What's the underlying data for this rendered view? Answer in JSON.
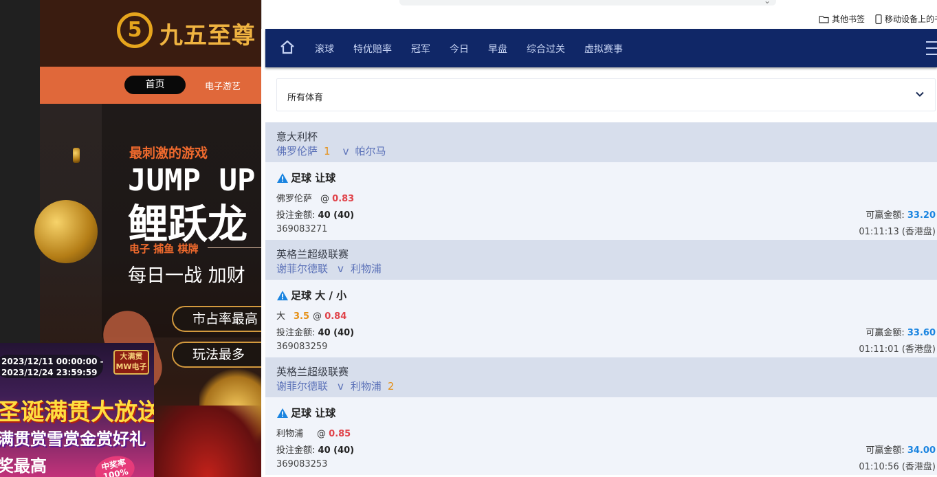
{
  "background_site": {
    "logo_char": "5",
    "logo_text": "九五至尊",
    "nav_home": "首页",
    "nav_egame": "电子游艺",
    "hero_line1": "最刺激的游戏",
    "hero_line2": "JUMP UP",
    "hero_line3": "鲤跃龙",
    "hero_line4": "电子  捕鱼  棋牌",
    "hero_line5": "每日一战  加财",
    "pill1": "市占率最高",
    "pill2": "玩法最多",
    "promo_date1": "2023/12/11 00:00:00 -",
    "promo_date2": "2023/12/24 23:59:59",
    "promo_badge1": "大满贯",
    "promo_badge2": "MW电子",
    "promo_title": "圣诞满贯大放送",
    "promo_sub": "满贯赏雪赏金赏好礼",
    "promo_sub2": "奖最高",
    "promo_rate1": "中奖率",
    "promo_rate2": "100%"
  },
  "browser": {
    "bookmark_other": "其他书签",
    "bookmark_mobile": "移动设备上的书"
  },
  "nav": {
    "items": [
      "滚球",
      "特优赔率",
      "冠军",
      "今日",
      "早盘",
      "综合过关",
      "虚拟赛事"
    ]
  },
  "sport_filter": {
    "label": "所有体育"
  },
  "labels": {
    "stake": "投注金额:",
    "win": "可赢金额:"
  },
  "bets": [
    {
      "league": "意大利杯",
      "home": "佛罗伦萨",
      "home_score": "1",
      "vs": "v",
      "away": "帕尔马",
      "away_score": "",
      "title": "足球 让球",
      "selection": "佛罗伦萨",
      "handicap": "",
      "at": "@",
      "odds": "0.83",
      "stake": "40 (40)",
      "win": "33.20",
      "ticket": "369083271",
      "time": "01:11:13 (香港盘)"
    },
    {
      "league": "英格兰超级联赛",
      "home": "谢菲尔德联",
      "home_score": "",
      "vs": "v",
      "away": "利物浦",
      "away_score": "",
      "title": "足球 大 / 小",
      "selection": "大",
      "handicap": "3.5",
      "at": "@",
      "odds": "0.84",
      "stake": "40 (40)",
      "win": "33.60",
      "ticket": "369083259",
      "time": "01:11:01 (香港盘)"
    },
    {
      "league": "英格兰超级联赛",
      "home": "谢菲尔德联",
      "home_score": "",
      "vs": "v",
      "away": "利物浦",
      "away_score": "2",
      "title": "足球 让球",
      "selection": "利物浦",
      "handicap": "",
      "at": "@",
      "odds": "0.85",
      "stake": "40 (40)",
      "win": "34.00",
      "ticket": "369083253",
      "time": "01:10:56 (香港盘)"
    }
  ],
  "colors": {
    "nav_bg": "#102767",
    "odds": "#e0434a",
    "win": "#1a84e0",
    "score": "#e58f14",
    "team": "#5b71b8"
  }
}
